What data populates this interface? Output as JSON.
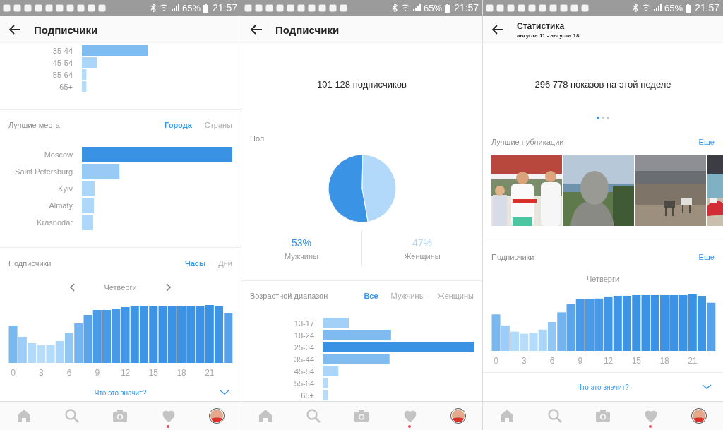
{
  "screens": [
    {
      "status_bar": {
        "battery": "65%",
        "time": "21:57"
      },
      "header": {
        "title": "Подписчики"
      },
      "sections": [
        {
          "kind": "age",
          "labels": [
            "35-44",
            "45-54",
            "55-64",
            "65+"
          ]
        },
        {
          "kind": "places",
          "divider": true,
          "title": "Лучшие места",
          "tabs": [
            {
              "label": "Города",
              "selected": true
            },
            {
              "label": "Страны",
              "selected": false
            }
          ],
          "labels": [
            "Moscow",
            "Saint Petersburg",
            "Kyiv",
            "Almaty",
            "Krasnodar"
          ]
        },
        {
          "kind": "hours",
          "divider": true,
          "title": "Подписчики",
          "tabs": [
            {
              "label": "Часы",
              "selected": true
            },
            {
              "label": "Дни",
              "selected": false
            }
          ],
          "day": {
            "label": "Четверги",
            "arrows": true
          },
          "axis_labels": [
            "0",
            "3",
            "6",
            "9",
            "12",
            "15",
            "18",
            "21"
          ]
        },
        {
          "kind": "help",
          "label": "Что это значит?"
        }
      ],
      "bottom_nav": {
        "activity_dot": true
      }
    },
    {
      "status_bar": {
        "battery": "65%",
        "time": "21:57"
      },
      "header": {
        "title": "Подписчики"
      },
      "sections": [
        {
          "kind": "total",
          "text": "101 128 подписчиков"
        },
        {
          "kind": "gender",
          "title": "Пол",
          "chart_data": {
            "type": "pie",
            "values": [
              53,
              47
            ]
          },
          "legend": [
            {
              "value": "53%",
              "label": "Мужчины",
              "color": "#3b93e6"
            },
            {
              "value": "47%",
              "label": "Женщины",
              "color": "#b3d9fa"
            }
          ]
        },
        {
          "kind": "age",
          "divider": true,
          "title": "Возрастной диапазон",
          "tabs": [
            {
              "label": "Все",
              "selected": true
            },
            {
              "label": "Мужчины",
              "selected": false
            },
            {
              "label": "Женщины",
              "selected": false
            }
          ],
          "labels": [
            "13-17",
            "18-24",
            "25-34",
            "35-44",
            "45-54",
            "55-64",
            "65+"
          ]
        }
      ],
      "bottom_nav": {
        "activity_dot": true
      }
    },
    {
      "status_bar": {
        "battery": "65%",
        "time": "21:57"
      },
      "header": {
        "title": "Статистика",
        "subtitle": "августа 11 - августа 18"
      },
      "sections": [
        {
          "kind": "total",
          "text": "296 778 показов на этой неделе",
          "dots": [
            {
              "selected": true
            },
            {
              "selected": false
            },
            {
              "selected": false
            }
          ]
        },
        {
          "kind": "posts",
          "title": "Лучшие публикации",
          "action": "Еще"
        },
        {
          "kind": "hours",
          "divider": true,
          "title": "Подписчики",
          "action": "Еще",
          "day": {
            "label": "Четверги",
            "arrows": false
          },
          "axis_labels": [
            "0",
            "3",
            "6",
            "9",
            "12",
            "15",
            "18",
            "21"
          ]
        },
        {
          "kind": "help",
          "divider": true,
          "label": "Что это значит?"
        }
      ],
      "bottom_nav": {
        "activity_dot": true
      }
    }
  ]
}
